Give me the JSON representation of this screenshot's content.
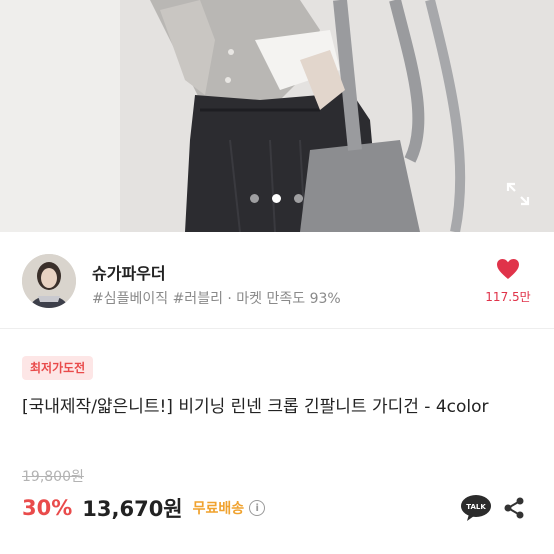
{
  "gallery": {
    "page_count": 3,
    "active_page": 2,
    "expand_icon": "expand-icon"
  },
  "seller": {
    "name": "슈가파우더",
    "tags": "#심플베이직 #러블리 · 마켓 만족도 93%",
    "like_count": "117.5만",
    "like_icon": "heart-icon",
    "heart_color": "#e0334a"
  },
  "product": {
    "badge": "최저가도전",
    "title": "[국내제작/얇은니트!] 비기닝 린넨 크롭 긴팔니트 가디건 - 4color",
    "original_price": "19,800원",
    "discount": "30%",
    "price": "13,670원",
    "shipping": "무료배송",
    "info_icon": "i"
  },
  "actions": {
    "talk_label": "TALK",
    "share_icon": "share-icon"
  },
  "colors": {
    "accent_red": "#e94b4b",
    "shipping_orange": "#f0a22e"
  }
}
